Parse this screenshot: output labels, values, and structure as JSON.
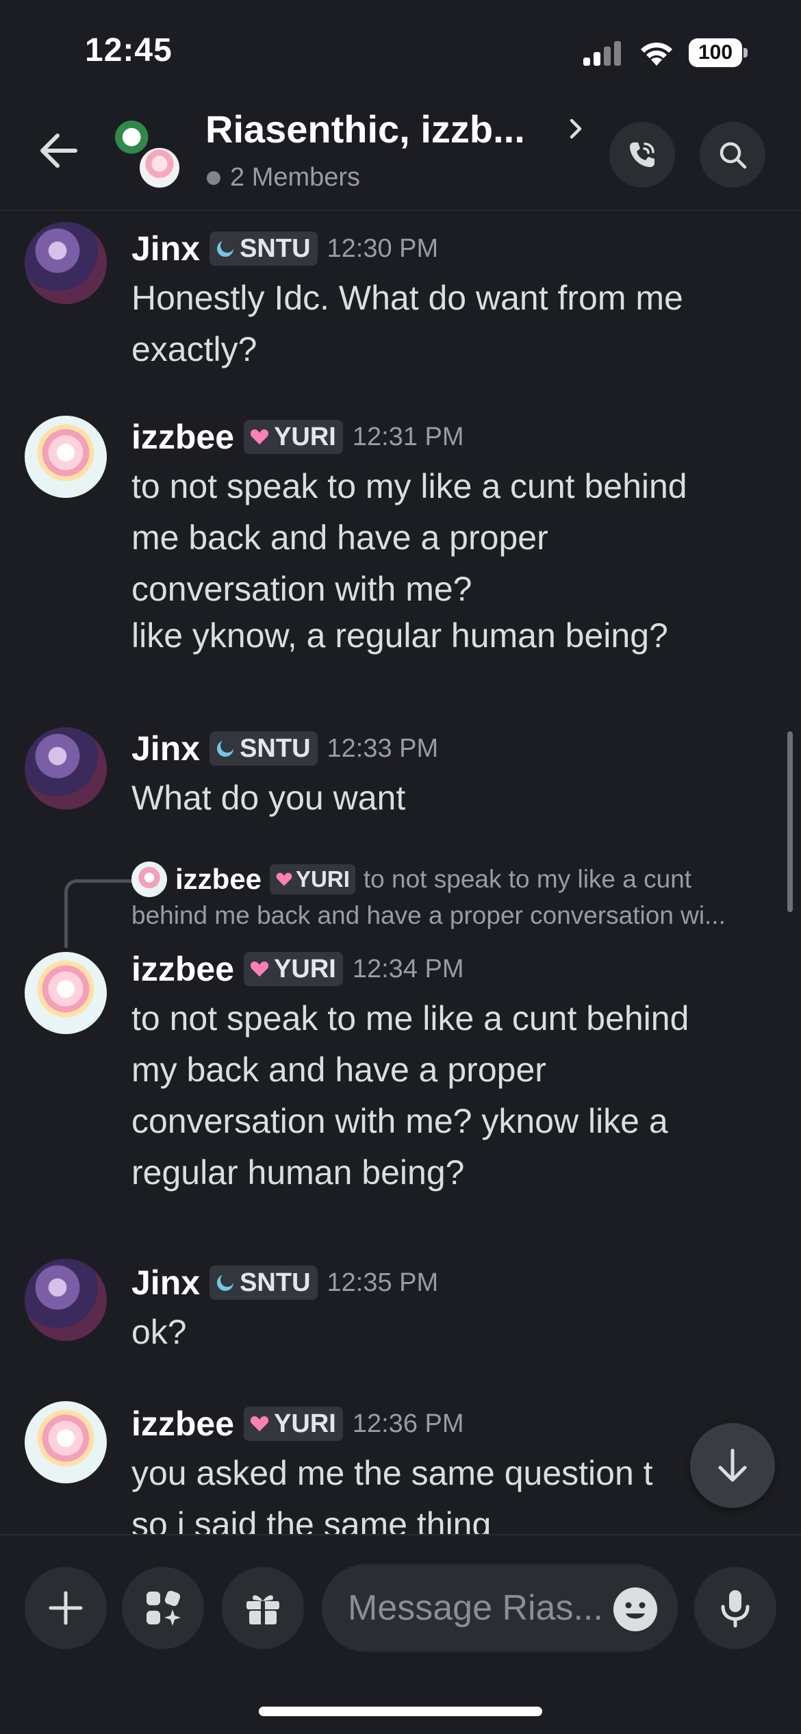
{
  "status_bar": {
    "time": "12:45",
    "battery": "100"
  },
  "header": {
    "title": "Riasenthic, izzb...",
    "members": "2 Members"
  },
  "tags": {
    "sntu": "SNTU",
    "yuri": "YURI"
  },
  "messages": [
    {
      "author": "Jinx",
      "time": "12:30 PM",
      "lines": [
        "Honestly Idc. What do want from me",
        "exactly?"
      ]
    },
    {
      "author": "izzbee",
      "time": "12:31 PM",
      "lines": [
        "to not speak to my like a cunt behind",
        "me back and have a proper",
        "conversation with me?"
      ],
      "followup": "like yknow, a regular human being?"
    },
    {
      "author": "Jinx",
      "time": "12:33 PM",
      "lines": [
        "What do you want"
      ]
    },
    {
      "author": "izzbee",
      "time": "12:34 PM",
      "lines": [
        "to not speak to me like a cunt behind",
        "my back and have a proper",
        "conversation with me? yknow like a",
        "regular human being?"
      ],
      "reply": {
        "author": "izzbee",
        "snippet": "to not speak to my like a cunt",
        "snippet_cont": "behind me back and have a proper conversation wi..."
      }
    },
    {
      "author": "Jinx",
      "time": "12:35 PM",
      "lines": [
        "ok?"
      ]
    },
    {
      "author": "izzbee",
      "time": "12:36 PM",
      "lines": [
        "you asked me the same question t",
        "so i said the same thing"
      ]
    }
  ],
  "composer": {
    "placeholder": "Message Rias..."
  },
  "icons": {
    "back": "arrow-left-icon",
    "call": "phone-call-icon",
    "search": "search-icon",
    "add": "plus-icon",
    "apps": "apps-icon",
    "gift": "gift-icon",
    "emoji": "emoji-icon",
    "mic": "microphone-icon",
    "jump": "arrow-down-icon"
  },
  "colors": {
    "background": "#1c1d22",
    "tag_bg": "#33363d",
    "muted": "#9a9ca3",
    "text": "#dbdee1"
  }
}
